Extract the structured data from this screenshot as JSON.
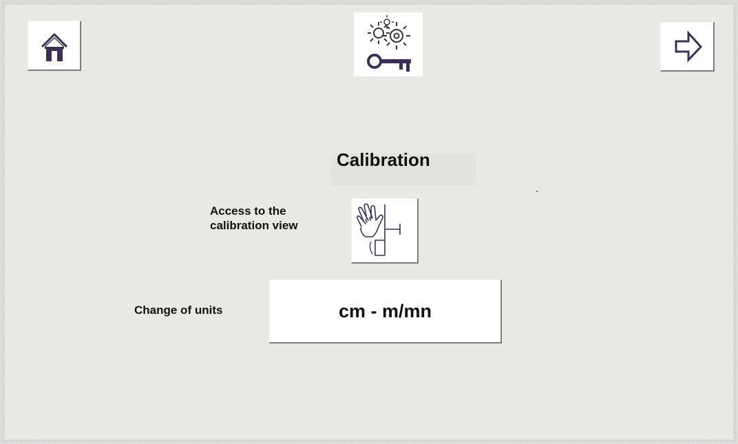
{
  "header": {
    "home_icon": "home-icon",
    "next_icon": "arrow-right-icon",
    "logo_icon": "gears-key-icon"
  },
  "main": {
    "title": "Calibration",
    "access_label_line1": "Access to the",
    "access_label_line2": "calibration view",
    "calibration_button_icon": "hand-calibration-icon",
    "units_label": "Change of units",
    "units_button_label": "cm - m/mn"
  },
  "colors": {
    "background": "#e8e8e5",
    "button": "#ffffff",
    "icon": "#3a2f55"
  }
}
